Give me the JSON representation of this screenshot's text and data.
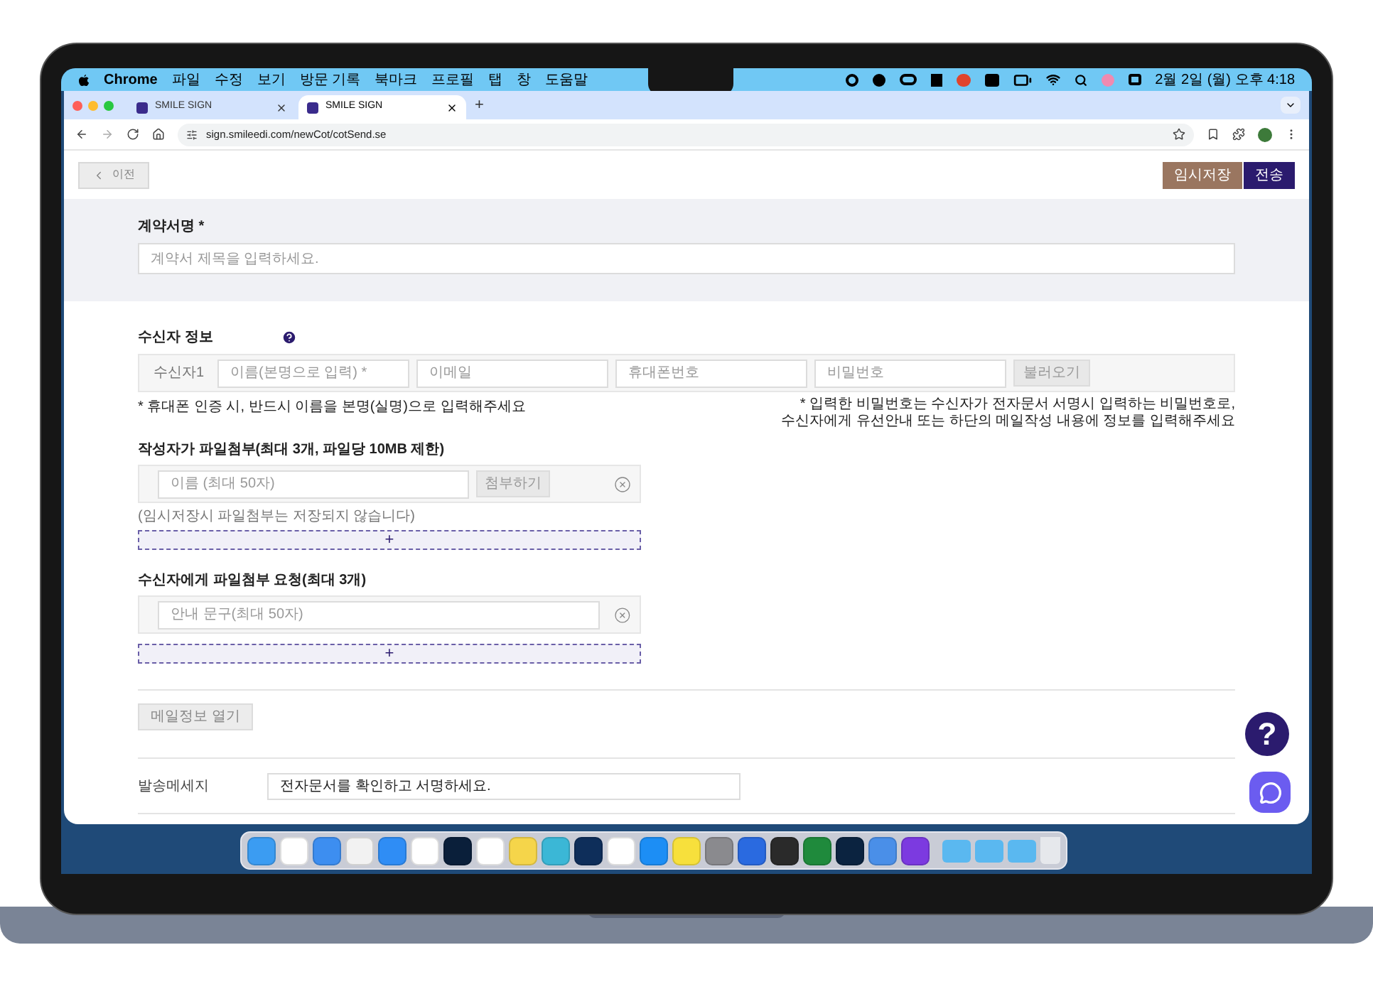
{
  "menubar": {
    "app": "Chrome",
    "menus": [
      "파일",
      "수정",
      "보기",
      "방문 기록",
      "북마크",
      "프로필",
      "탭",
      "창",
      "도움말"
    ],
    "clock": "2월 2일 (월) 오후 4:18"
  },
  "tabs": [
    {
      "title": "SMILE SIGN",
      "selected": false
    },
    {
      "title": "SMILE SIGN",
      "selected": true
    }
  ],
  "new_tab": "+",
  "address_bar": {
    "url": "sign.smileedi.com/newCot/cotSend.se"
  },
  "toolbar": {
    "back_button": "이전",
    "buttons": [
      {
        "label": "임시저장",
        "kind": "save"
      },
      {
        "label": "전송",
        "kind": "send"
      }
    ]
  },
  "contract_title": {
    "label": "계약서명 *",
    "placeholder": "계약서 제목을 입력하세요."
  },
  "recipients": {
    "label": "수신자 정보",
    "rows": [
      {
        "label": "수신자1",
        "fields": [
          {
            "placeholder": "이름(본명으로 입력) *"
          },
          {
            "placeholder": "이메일"
          },
          {
            "placeholder": "휴대폰번호"
          },
          {
            "placeholder": "비밀번호"
          }
        ],
        "button": "불러오기"
      }
    ],
    "note_left": "* 휴대폰 인증 시, 반드시 이름을 본명(실명)으로 입력해주세요",
    "note_right": [
      "* 입력한 비밀번호는 수신자가 전자문서 서명시 입력하는 비밀번호로,",
      "수신자에게 유선안내 또는 하단의 메일작성 내용에 정보를 입력해주세요"
    ]
  },
  "author_files": {
    "label": "작성자가 파일첨부(최대 3개, 파일당 10MB 제한)",
    "rows": [
      {
        "placeholder": "이름 (최대 50자)",
        "button": "첨부하기"
      }
    ],
    "note": "(임시저장시 파일첨부는 저장되지 않습니다)",
    "add": "+"
  },
  "request_files": {
    "label": "수신자에게 파일첨부 요청(최대 3개)",
    "rows": [
      {
        "placeholder": "안내 문구(최대 50자)"
      }
    ],
    "add": "+"
  },
  "mail_info_button": "메일정보 열기",
  "message": {
    "label": "발송메세지",
    "value": "전자문서를 확인하고 서명하세요."
  },
  "help_button": "?"
}
